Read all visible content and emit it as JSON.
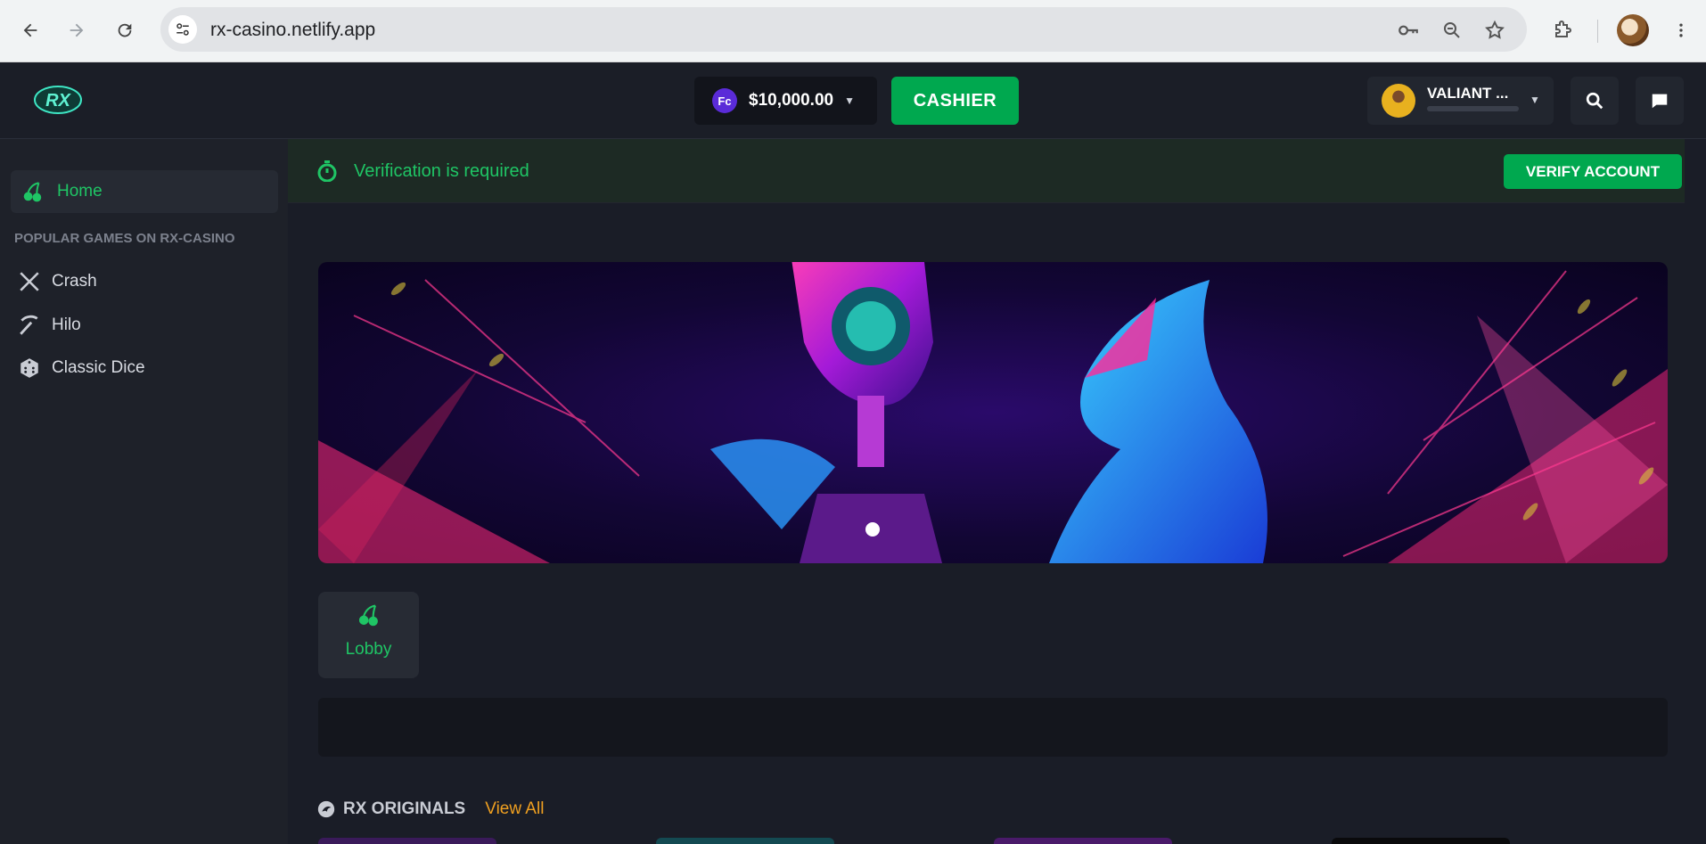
{
  "browser": {
    "url": "rx-casino.netlify.app"
  },
  "header": {
    "logo_text": "RX",
    "balance": "$10,000.00",
    "coin_symbol": "Fc",
    "cashier_label": "CASHIER",
    "username": "VALIANT ...",
    "accent_color": "#00a84f"
  },
  "sidebar": {
    "home_label": "Home",
    "section_heading": "POPULAR GAMES ON RX-CASINO",
    "items": [
      {
        "label": "Crash",
        "icon": "swords-icon"
      },
      {
        "label": "Hilo",
        "icon": "pickaxe-icon"
      },
      {
        "label": "Classic Dice",
        "icon": "dice-icon"
      }
    ]
  },
  "main": {
    "verification_text": "Verification is required",
    "verify_button": "VERIFY ACCOUNT",
    "lobby_label": "Lobby",
    "originals_title": "RX ORIGINALS",
    "view_all": "View All"
  }
}
